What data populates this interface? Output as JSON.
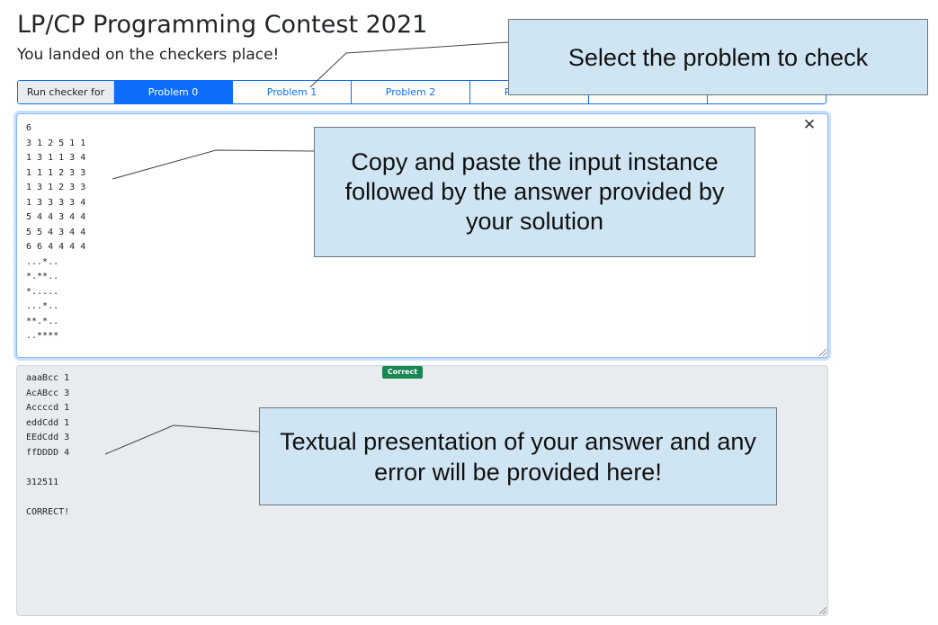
{
  "page": {
    "title": "LP/CP Programming Contest 2021",
    "subtitle": "You landed on the checkers place!"
  },
  "toolbar": {
    "run_label": "Run checker for",
    "tabs": [
      {
        "label": "Problem 0",
        "active": true
      },
      {
        "label": "Problem 1",
        "active": false
      },
      {
        "label": "Problem 2",
        "active": false
      },
      {
        "label": "Problem 3",
        "active": false
      },
      {
        "label": "Problem 4",
        "active": false
      },
      {
        "label": "Problem 5",
        "active": false
      }
    ]
  },
  "input": {
    "text": "6\n3 1 2 5 1 1\n1 3 1 1 3 4\n1 1 1 2 3 3\n1 3 1 2 3 3\n1 3 3 3 3 4\n5 4 4 3 4 4\n5 5 4 3 4 4\n6 6 4 4 4 4\n...*..\n*.**..\n*.....\n...*..\n**.*..\n..****",
    "clear_symbol": "✕"
  },
  "output": {
    "status": "Correct",
    "text": "aaaBcc 1\nAcABcc 3\nAccccd 1\neddCdd 1\nEEdCdd 3\nffDDDD 4\n\n312511\n\nCORRECT!"
  },
  "annotations": {
    "select_problem": "Select the problem to check",
    "input_help": "Copy and paste the input instance followed by the answer provided by your solution",
    "output_help": "Textual presentation of your answer and any error will be provided here!"
  },
  "colors": {
    "primary": "#0d6efd",
    "success": "#198754",
    "callout_bg": "#cfe5f3",
    "readonly_bg": "#e9ecef"
  }
}
